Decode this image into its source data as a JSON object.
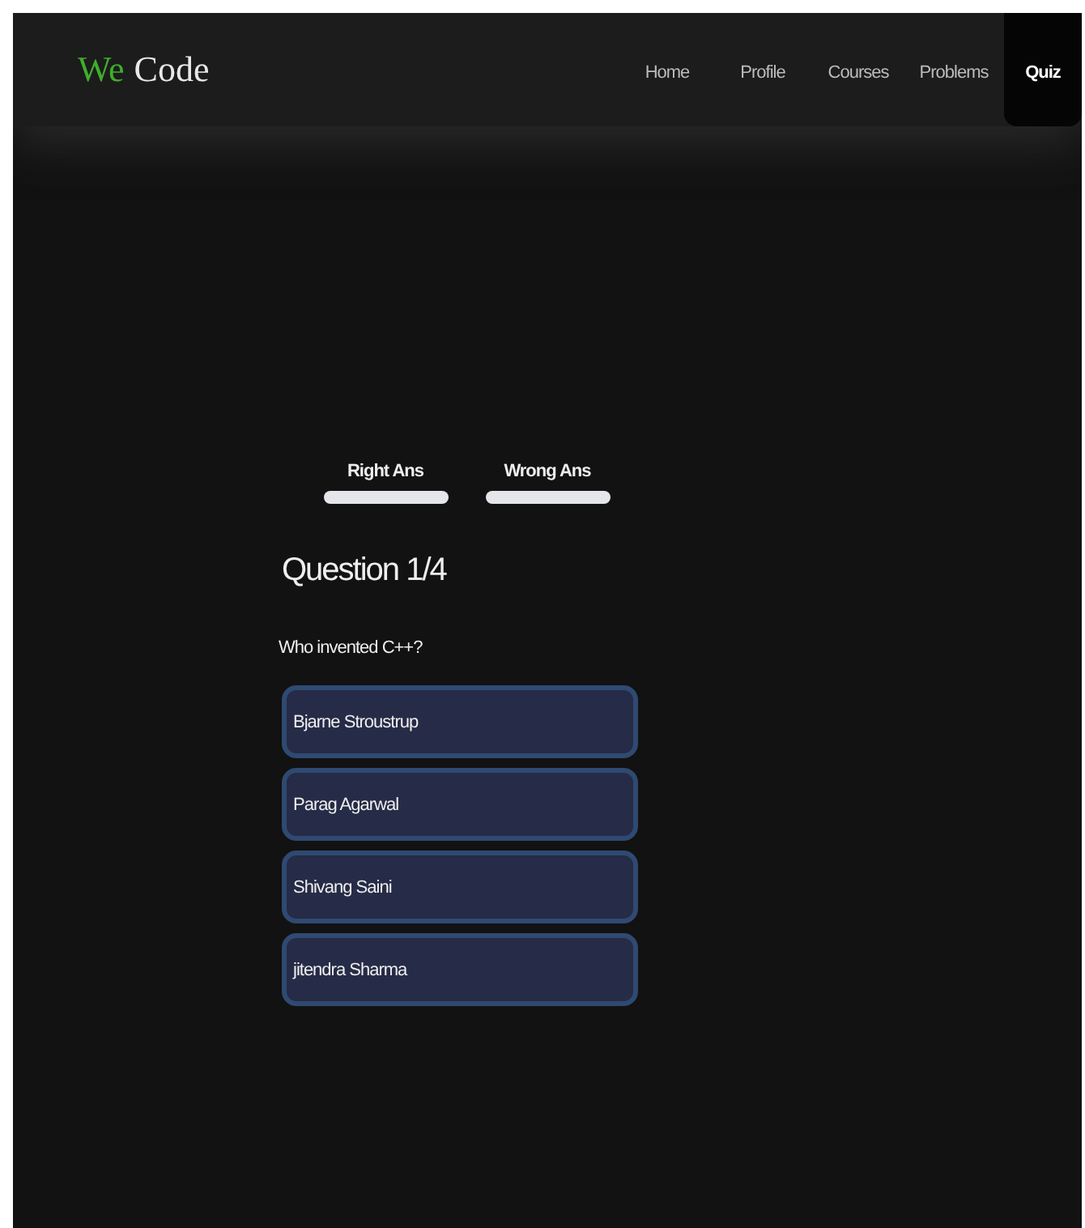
{
  "logo": {
    "accent": "We",
    "rest": "Code"
  },
  "nav": [
    {
      "label": "Home",
      "selected": false
    },
    {
      "label": "Profile",
      "selected": false
    },
    {
      "label": "Courses",
      "selected": false
    },
    {
      "label": "Problems",
      "selected": false
    },
    {
      "label": "Quiz",
      "selected": true
    }
  ],
  "score": [
    {
      "label": "Right Ans"
    },
    {
      "label": "Wrong Ans"
    }
  ],
  "quiz": {
    "heading": "Question 1/4",
    "question": "Who invented C++?",
    "options": [
      "Bjarne Stroustrup",
      "Parag Agarwal",
      "Shivang Saini",
      "jitendra Sharma"
    ]
  }
}
